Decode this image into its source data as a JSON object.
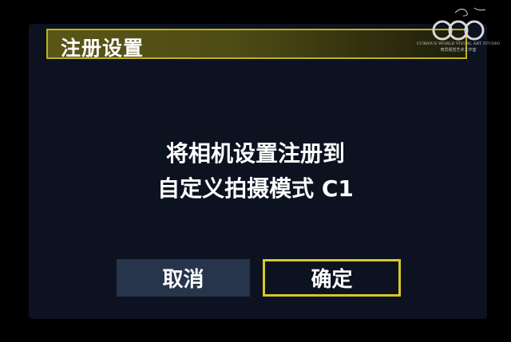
{
  "dialog": {
    "title": "注册设置",
    "message_line1": "将相机设置注册到",
    "message_line2": "自定义拍摄模式 C1",
    "cancel_label": "取消",
    "ok_label": "确定"
  },
  "watermark": {
    "line1": "CURIOUS WORLD VISUAL ART STUDIO",
    "line2": "奇异视觉艺术工作室"
  },
  "colors": {
    "screen_bg": "#0c1220",
    "title_border": "#bdb31c",
    "selected_border": "#d8c62a",
    "cancel_bg": "#26354b"
  }
}
